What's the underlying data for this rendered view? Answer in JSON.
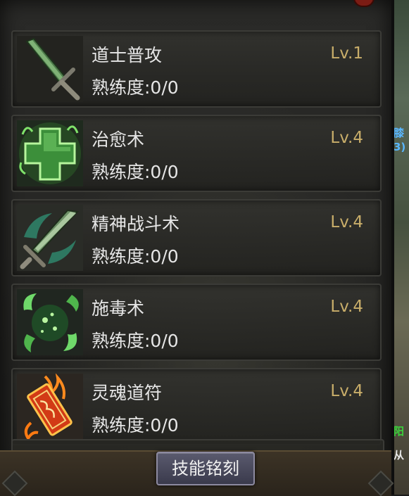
{
  "skills": [
    {
      "name": "道士普攻",
      "proficiency": "熟练度:0/0",
      "level": "Lv.1",
      "icon": "sword-icon"
    },
    {
      "name": "治愈术",
      "proficiency": "熟练度:0/0",
      "level": "Lv.4",
      "icon": "heal-cross-icon"
    },
    {
      "name": "精神战斗术",
      "proficiency": "熟练度:0/0",
      "level": "Lv.4",
      "icon": "spirit-sword-icon"
    },
    {
      "name": "施毒术",
      "proficiency": "熟练度:0/0",
      "level": "Lv.4",
      "icon": "poison-orb-icon"
    },
    {
      "name": "灵魂道符",
      "proficiency": "熟练度:0/0",
      "level": "Lv.4",
      "icon": "talisman-icon"
    }
  ],
  "engrave_button": "技能铭刻",
  "map_side": {
    "t1": "膝",
    "t2": "3)",
    "t3": "阳",
    "t4": "从"
  },
  "colors": {
    "level": "#c9ae6a",
    "text": "#e6e6e6",
    "accent_green": "#3bd13b"
  }
}
